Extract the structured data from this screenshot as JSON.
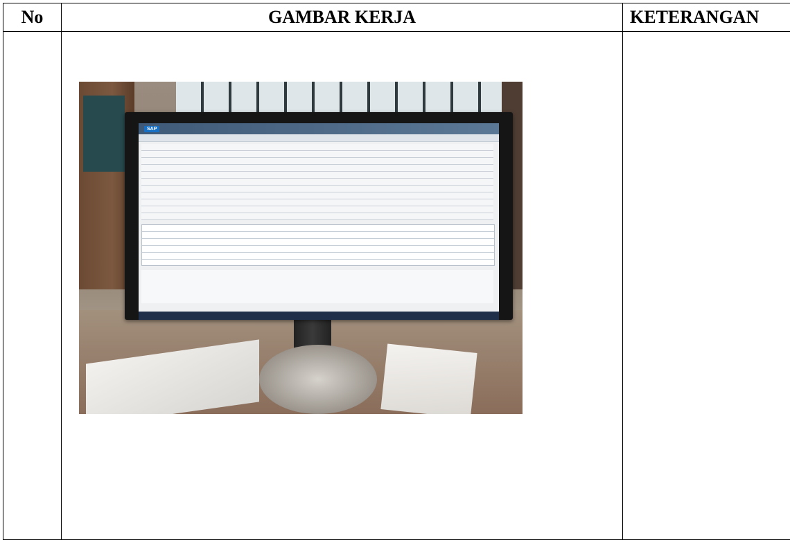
{
  "table": {
    "headers": {
      "no": "No",
      "gambar_kerja": "GAMBAR KERJA",
      "keterangan": "KETERANGAN"
    }
  },
  "photo": {
    "screen_app": "SAP"
  }
}
